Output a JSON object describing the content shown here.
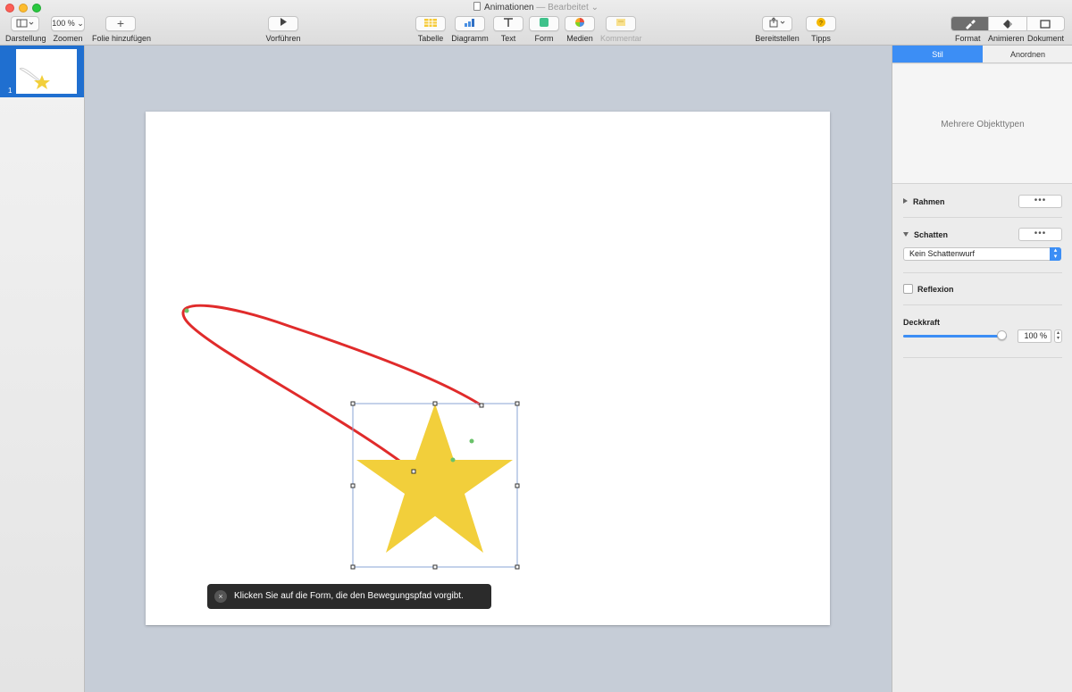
{
  "window": {
    "title": "Animationen",
    "status": "— Bearbeitet",
    "status_chevron": "⌄"
  },
  "toolbar": {
    "darstellung": "Darstellung",
    "zoom_value": "100 %",
    "zoom_label": "Zoomen",
    "add_slide_label": "Folie hinzufügen",
    "play_label": "Vorführen",
    "table_label": "Tabelle",
    "chart_label": "Diagramm",
    "text_label": "Text",
    "shape_label": "Form",
    "media_label": "Medien",
    "comment_label": "Kommentar",
    "share_label": "Bereitstellen",
    "tips_label": "Tipps",
    "format_label": "Format",
    "animate_label": "Animieren",
    "document_label": "Dokument"
  },
  "navigator": {
    "slides": [
      {
        "number": "1"
      }
    ]
  },
  "canvas": {
    "hint_text": "Klicken Sie auf die Form, die den Bewegungspfad vorgibt.",
    "hint_close": "×",
    "star_color": "#f2cf3b",
    "path_color": "#e02b2b"
  },
  "inspector": {
    "tabs": [
      "Stil",
      "Anordnen"
    ],
    "active_tab": "Stil",
    "header_text": "Mehrere Objekttypen",
    "border_label": "Rahmen",
    "shadow_label": "Schatten",
    "shadow_value": "Kein Schattenwurf",
    "reflection_label": "Reflexion",
    "reflection_checked": false,
    "opacity_label": "Deckkraft",
    "opacity_value": "100 %",
    "opacity_fraction": 1.0,
    "dots": "•••"
  },
  "colors": {
    "accent": "#3c8ef5",
    "selection_blue": "#1f6fd0"
  }
}
